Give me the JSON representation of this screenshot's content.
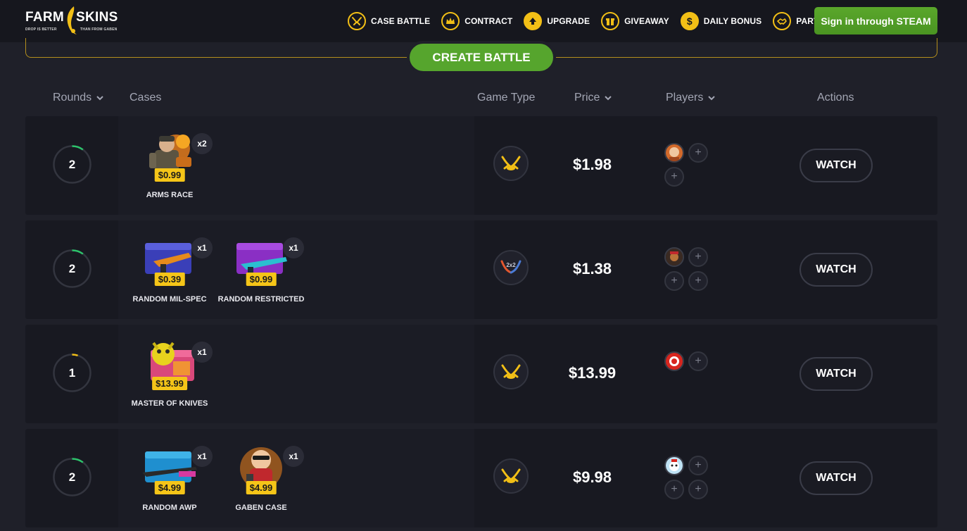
{
  "logo": {
    "left": "FARM",
    "right": "SKINS",
    "tagline_left": "DROP IS BETTER",
    "tagline_right": "THAN FROM GABEN"
  },
  "nav": [
    {
      "label": "CASE BATTLE",
      "icon": "crossed-swords-icon"
    },
    {
      "label": "CONTRACT",
      "icon": "crown-icon"
    },
    {
      "label": "UPGRADE",
      "icon": "arrow-up-icon"
    },
    {
      "label": "GIVEAWAY",
      "icon": "gift-icon"
    },
    {
      "label": "DAILY BONUS",
      "icon": "dollar-coin-icon"
    },
    {
      "label": "PARTNER",
      "icon": "handshake-icon"
    }
  ],
  "signin_label": "Sign in through STEAM",
  "create_battle_label": "CREATE BATTLE",
  "columns": {
    "rounds": "Rounds",
    "cases": "Cases",
    "game_type": "Game Type",
    "price": "Price",
    "players": "Players",
    "actions": "Actions"
  },
  "battles": [
    {
      "rounds": "2",
      "round_progress": 0.1,
      "cases": [
        {
          "name": "ARMS RACE",
          "price": "$0.99",
          "count": "x2",
          "art": "soldier"
        }
      ],
      "game_type": "1v1",
      "price": "$1.98",
      "players_filled": 1,
      "players_total": 3,
      "watch_label": "WATCH"
    },
    {
      "rounds": "2",
      "round_progress": 0.1,
      "cases": [
        {
          "name": "RANDOM MIL-SPEC",
          "price": "$0.39",
          "count": "x1",
          "art": "blue-box"
        },
        {
          "name": "RANDOM RESTRICTED",
          "price": "$0.99",
          "count": "x1",
          "art": "purple-box"
        }
      ],
      "game_type": "2x2",
      "game_type_text": "2x2",
      "price": "$1.38",
      "players_filled": 1,
      "players_total": 4,
      "watch_label": "WATCH"
    },
    {
      "rounds": "1",
      "round_progress": 0.05,
      "cases": [
        {
          "name": "MASTER OF KNIVES",
          "price": "$13.99",
          "count": "x1",
          "art": "pink-box"
        }
      ],
      "game_type": "1v1",
      "price": "$13.99",
      "players_filled": 1,
      "players_total": 2,
      "watch_label": "WATCH"
    },
    {
      "rounds": "2",
      "round_progress": 0.1,
      "cases": [
        {
          "name": "RANDOM AWP",
          "price": "$4.99",
          "count": "x1",
          "art": "cyan-box"
        },
        {
          "name": "GABEN CASE",
          "price": "$4.99",
          "count": "x1",
          "art": "gaben"
        }
      ],
      "game_type": "1v1",
      "price": "$9.98",
      "players_filled": 1,
      "players_total": 4,
      "watch_label": "WATCH"
    }
  ],
  "colors": {
    "accent_gold": "#f2bf16",
    "accent_green": "#56a52d",
    "bg": "#1f2029",
    "row_bg": "#181921"
  }
}
